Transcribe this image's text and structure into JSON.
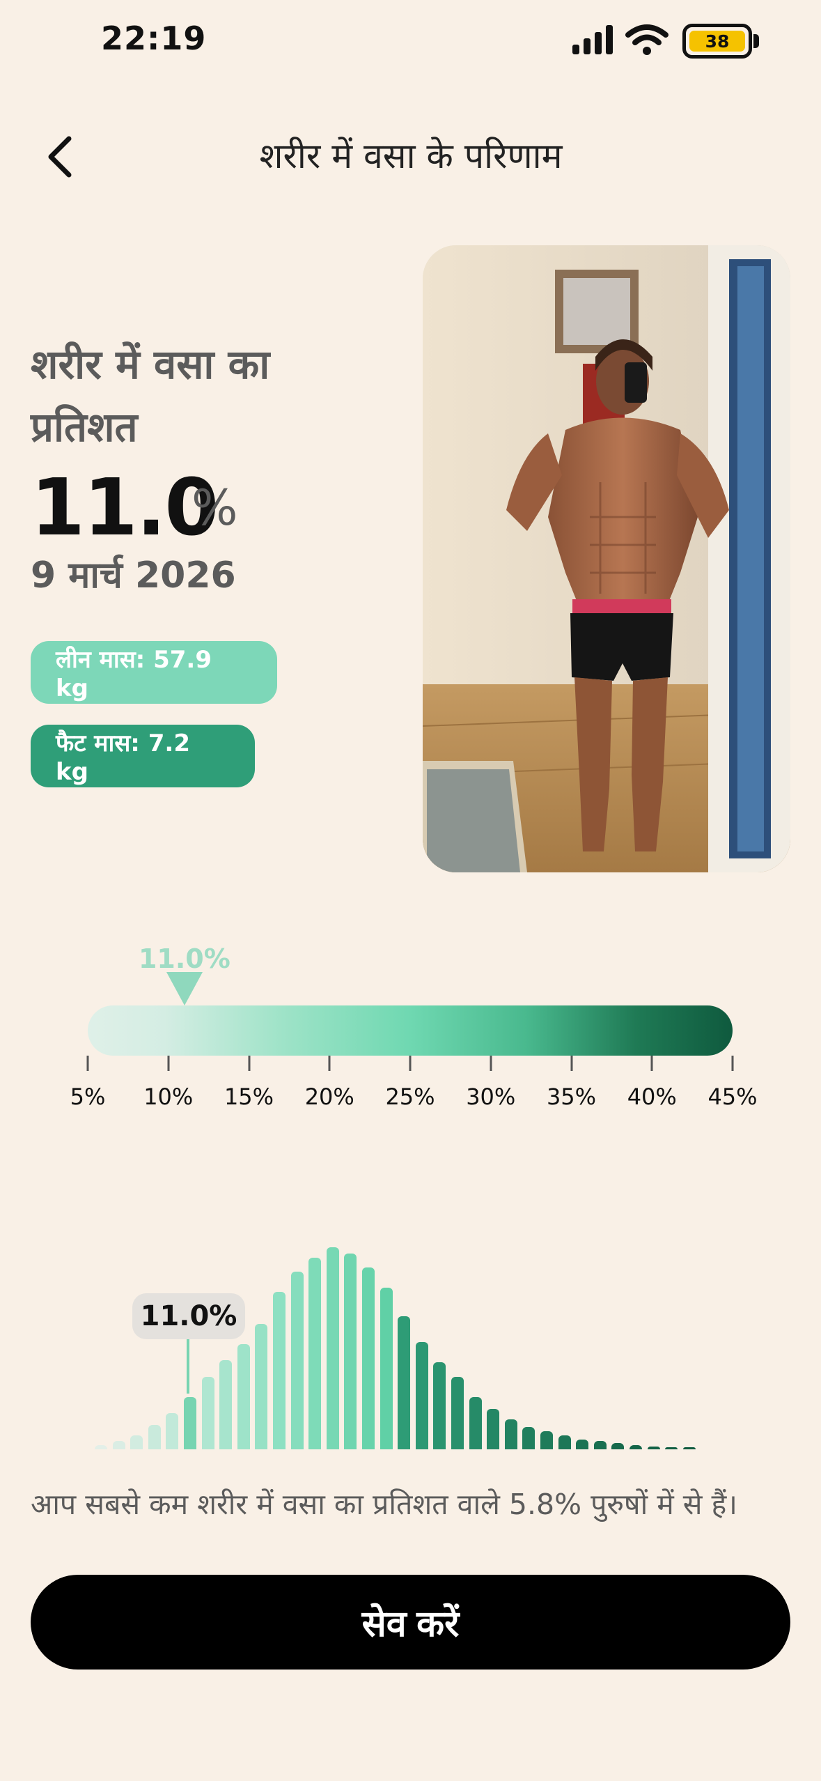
{
  "status_bar": {
    "time": "22:19",
    "battery_level": "38",
    "icons": [
      "cellular-signal-icon",
      "wifi-icon",
      "battery-icon"
    ]
  },
  "header": {
    "back_icon": "chevron-left-icon",
    "title": "शरीर में वसा के परिणाम"
  },
  "result": {
    "heading_line1": "शरीर में वसा का",
    "heading_line2": "प्रतिशत",
    "value": "11.0",
    "unit": "%",
    "date": "9 मार्च 2026",
    "lean_mass": "लीन मास: 57.9 kg",
    "fat_mass": "फैट मास: 7.2 kg"
  },
  "scale": {
    "marker_label": "11.0%",
    "marker_value": 11.0,
    "min": 5,
    "max": 45,
    "ticks": [
      "5%",
      "10%",
      "15%",
      "20%",
      "25%",
      "30%",
      "35%",
      "40%",
      "45%"
    ]
  },
  "histogram": {
    "callout": "11.0%",
    "highlight_bin": 5,
    "heights": [
      0.02,
      0.04,
      0.07,
      0.12,
      0.18,
      0.26,
      0.36,
      0.44,
      0.52,
      0.62,
      0.78,
      0.88,
      0.95,
      1.0,
      0.97,
      0.9,
      0.8,
      0.66,
      0.53,
      0.43,
      0.36,
      0.26,
      0.2,
      0.15,
      0.11,
      0.09,
      0.07,
      0.05,
      0.04,
      0.03,
      0.02,
      0.015,
      0.012,
      0.01
    ]
  },
  "summary": "आप सबसे कम शरीर में वसा का प्रतिशत वाले 5.8% पुरुषों में से हैं।",
  "save_button": "सेव करें",
  "colors": {
    "background": "#f9f0e6",
    "lean_pill": "#7dd7b8",
    "fat_pill": "#2f9e78",
    "button": "#000000"
  }
}
